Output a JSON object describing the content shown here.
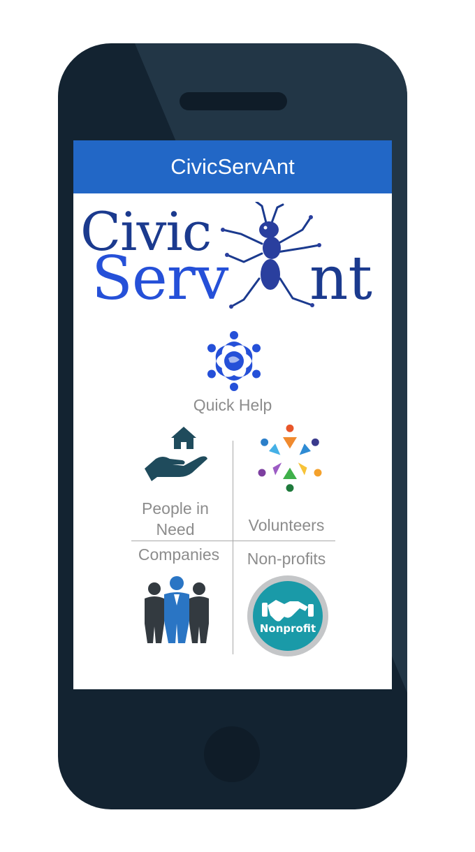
{
  "app_bar": {
    "title": "CivicServAnt"
  },
  "logo": {
    "line1": "Civic",
    "line2_part1": "Serv",
    "line2_part2": "nt"
  },
  "quick_help": {
    "label": "Quick Help",
    "icon": "globe-people-icon"
  },
  "categories": {
    "people_in_need": {
      "label_line1": "People in",
      "label_line2": "Need",
      "icon": "hand-house-icon"
    },
    "volunteers": {
      "label": "Volunteers",
      "icon": "people-circle-icon"
    },
    "companies": {
      "label": "Companies",
      "icon": "business-people-icon"
    },
    "nonprofits": {
      "label": "Non-profits",
      "icon": "handshake-badge-icon",
      "badge_text": "Nonprofit"
    }
  },
  "colors": {
    "app_bar": "#2267c6",
    "logo_dark": "#1b3a8e",
    "logo_light": "#2550d8",
    "label_gray": "#8c8c8c",
    "phone_body": "#132331",
    "nonprofit_teal": "#1a9aa8"
  }
}
